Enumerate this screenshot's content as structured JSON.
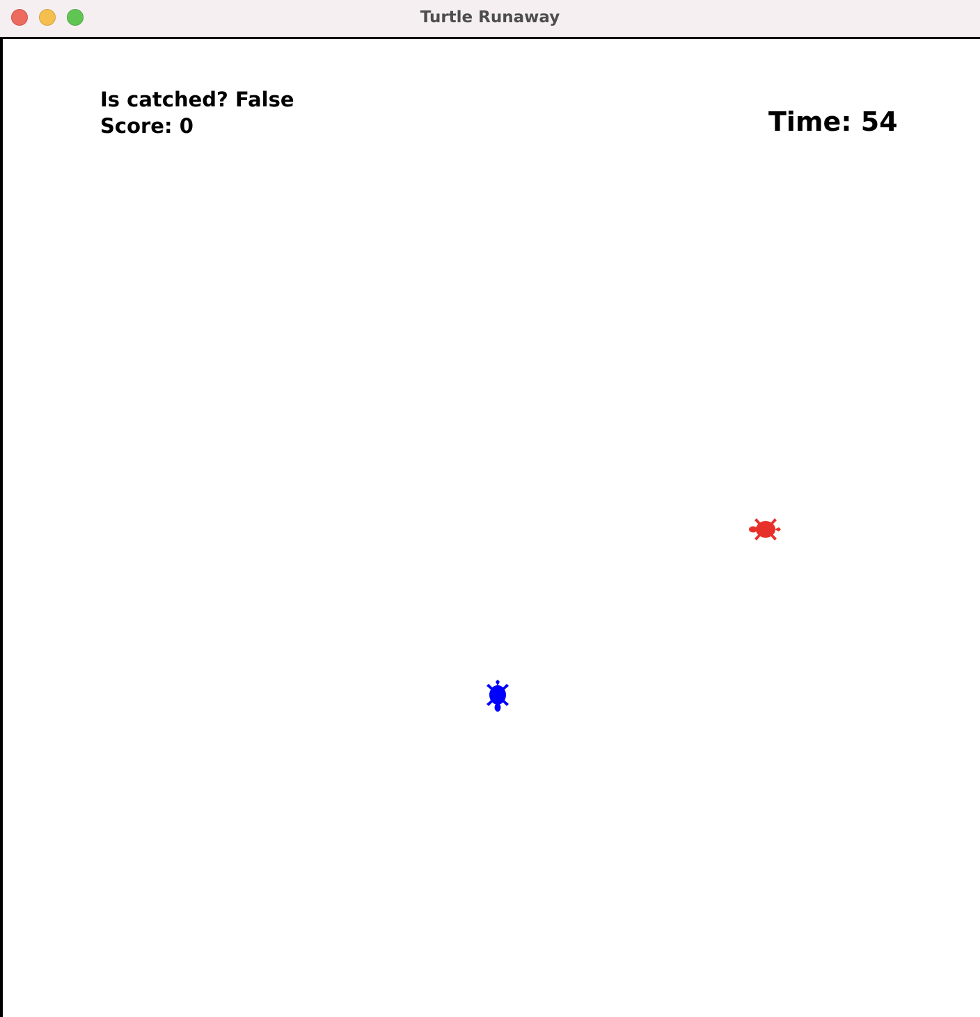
{
  "window": {
    "title": "Turtle Runaway"
  },
  "hud": {
    "status_label": "Is catched?",
    "status_value": "False",
    "score_label": "Score:",
    "score_value": "0",
    "time_label": "Time:",
    "time_value": "54"
  },
  "sprites": {
    "chaser": {
      "icon": "turtle-icon",
      "color": "#0000ff",
      "heading": "down"
    },
    "runner": {
      "icon": "turtle-icon",
      "color": "#e8302a",
      "heading": "left"
    }
  },
  "colors": {
    "titlebar_bg": "#f5eff2",
    "close": "#ed6a5e",
    "minimize": "#f5bf4f",
    "maximize": "#61c554"
  }
}
